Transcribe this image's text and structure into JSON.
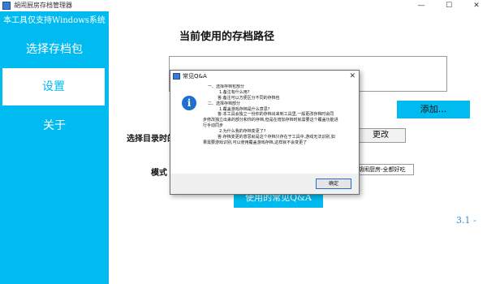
{
  "window": {
    "title": "胡闹厨房存档管理器",
    "minimize": "—",
    "maximize": "☐",
    "close": "✕"
  },
  "sidebar": {
    "banner": "本工具仅支持Windows系统",
    "items": [
      {
        "label": "选择存档包"
      },
      {
        "label": "设置"
      },
      {
        "label": "关于"
      }
    ]
  },
  "main": {
    "heading": "当前使用的存档路径",
    "path_value": "",
    "add_button": "添加...",
    "select_label": "选择目录时的",
    "change_button": "更改",
    "mode_label": "模式",
    "mode_selected": "胡闹厨房-全都好吃",
    "faq_button": "使用的常见Q&A",
    "version": "3.1 -"
  },
  "dialog": {
    "title": "常见Q&A",
    "close": "✕",
    "icon": "i",
    "lines": [
      "一、选择存档包部分",
      "1.备注有什么用?",
      "答:备注可以方便区分不同的存档包",
      "二、选择存档部分",
      "1.覆盖游戏存档是什么意思?",
      "答:本工具会独立一份你的存档出来到工具里,一般更改存档时会同",
      "步修改独立出来的部分和你的存档,但是在增加存档时就需要这个覆盖功能进",
      "行手动同步",
      "2.为什么我的存档变更了?",
      "答:存档变更的意思就是这个存档只存在于工具中,游戏无法识别,如",
      "果需要游戏识别,可以使用覆盖游戏存档,这样就不会变更了"
    ],
    "ok_button": "确定"
  },
  "colors": {
    "accent": "#00bbf0",
    "version_text": "#3a8fd0"
  }
}
